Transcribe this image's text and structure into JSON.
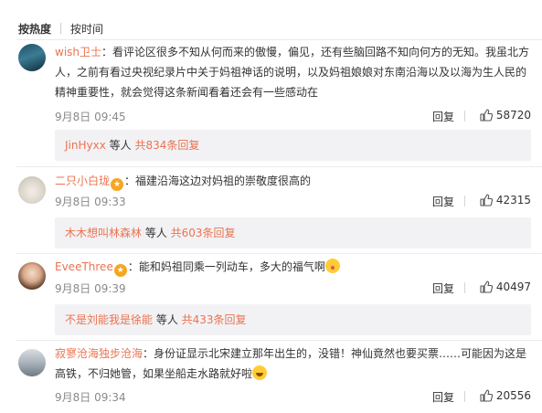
{
  "sort": {
    "hot": "按热度",
    "time": "按时间"
  },
  "comments": [
    {
      "user": "wish卫士",
      "text": "：看评论区很多不知从何而来的傲慢，偏见，还有些脑回路不知向何方的无知。我虽北方人，之前有看过央视纪录片中关于妈祖神话的说明，以及妈祖娘娘对东南沿海以及以海为生人民的精神重要性，就会觉得这条新闻看着还会有一些感动在",
      "time": "9月8日 09:45",
      "reply_label": "回复",
      "likes": "58720",
      "sub_names": "JinHyxx",
      "sub_mid": " 等人 ",
      "sub_count": "共834条回复"
    },
    {
      "user": "二只小白珑",
      "text": "：福建沿海这边对妈祖的崇敬度很高的",
      "time": "9月8日 09:33",
      "reply_label": "回复",
      "likes": "42315",
      "sub_names": "木木想叫林森林",
      "sub_mid": " 等人 ",
      "sub_count": "共603条回复"
    },
    {
      "user": "EveeThree",
      "text": "：能和妈祖同乘一列动车，多大的福气啊",
      "time": "9月8日 09:39",
      "reply_label": "回复",
      "likes": "40497",
      "sub_names": "不是刘能我是徐能",
      "sub_mid": " 等人 ",
      "sub_count": "共433条回复"
    },
    {
      "user": "寂寥沧海独步沧海",
      "text": "：身份证显示北宋建立那年出生的，没错！神仙竟然也要买票……可能因为这是高铁，不归她管，如果坐船走水路就好啦",
      "time": "9月8日 09:34",
      "reply_label": "回复",
      "likes": "20556"
    }
  ],
  "colors": {
    "link": "#eb7350",
    "subreply_bg": "#f2f2f5"
  },
  "icons": [
    "thumb-up-icon",
    "medal-icon",
    "laugh-emoji-icon",
    "kiss-emoji-icon"
  ]
}
